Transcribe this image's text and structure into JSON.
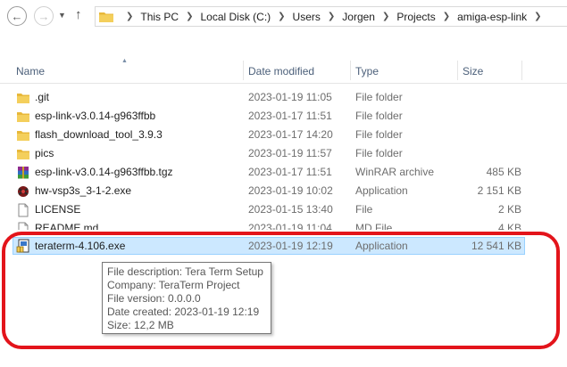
{
  "address_bar": {
    "breadcrumbs": [
      "This PC",
      "Local Disk (C:)",
      "Users",
      "Jorgen",
      "Projects",
      "amiga-esp-link"
    ]
  },
  "columns": {
    "name": "Name",
    "date_modified": "Date modified",
    "type": "Type",
    "size": "Size"
  },
  "files": [
    {
      "name": ".git",
      "date": "2023-01-19 11:05",
      "type": "File folder",
      "size": "",
      "icon": "folder-icon"
    },
    {
      "name": "esp-link-v3.0.14-g963ffbb",
      "date": "2023-01-17 11:51",
      "type": "File folder",
      "size": "",
      "icon": "folder-icon"
    },
    {
      "name": "flash_download_tool_3.9.3",
      "date": "2023-01-17 14:20",
      "type": "File folder",
      "size": "",
      "icon": "folder-icon"
    },
    {
      "name": "pics",
      "date": "2023-01-19 11:57",
      "type": "File folder",
      "size": "",
      "icon": "folder-icon"
    },
    {
      "name": "esp-link-v3.0.14-g963ffbb.tgz",
      "date": "2023-01-17 11:51",
      "type": "WinRAR archive",
      "size": "485 KB",
      "icon": "winrar-archive-icon"
    },
    {
      "name": "hw-vsp3s_3-1-2.exe",
      "date": "2023-01-19 10:02",
      "type": "Application",
      "size": "2 151 KB",
      "icon": "application-icon"
    },
    {
      "name": "LICENSE",
      "date": "2023-01-15 13:40",
      "type": "File",
      "size": "2 KB",
      "icon": "file-icon"
    },
    {
      "name": "README.md",
      "date": "2023-01-19 11:04",
      "type": "MD File",
      "size": "4 KB",
      "icon": "file-icon"
    }
  ],
  "selected_file": {
    "name": "teraterm-4.106.exe",
    "date": "2023-01-19 12:19",
    "type": "Application",
    "size": "12 541 KB",
    "icon": "installer-icon"
  },
  "tooltip": {
    "lines": [
      "File description: Tera Term Setup",
      "Company: TeraTerm Project",
      "File version: 0.0.0.0",
      "Date created: 2023-01-19 12:19",
      "Size: 12,2 MB"
    ]
  },
  "colors": {
    "selection_bg": "#cce8ff",
    "selection_border": "#99d1ff",
    "annotation_red": "#e3141b",
    "folder_yellow": "#e8b83a",
    "header_text": "#4c607a"
  }
}
